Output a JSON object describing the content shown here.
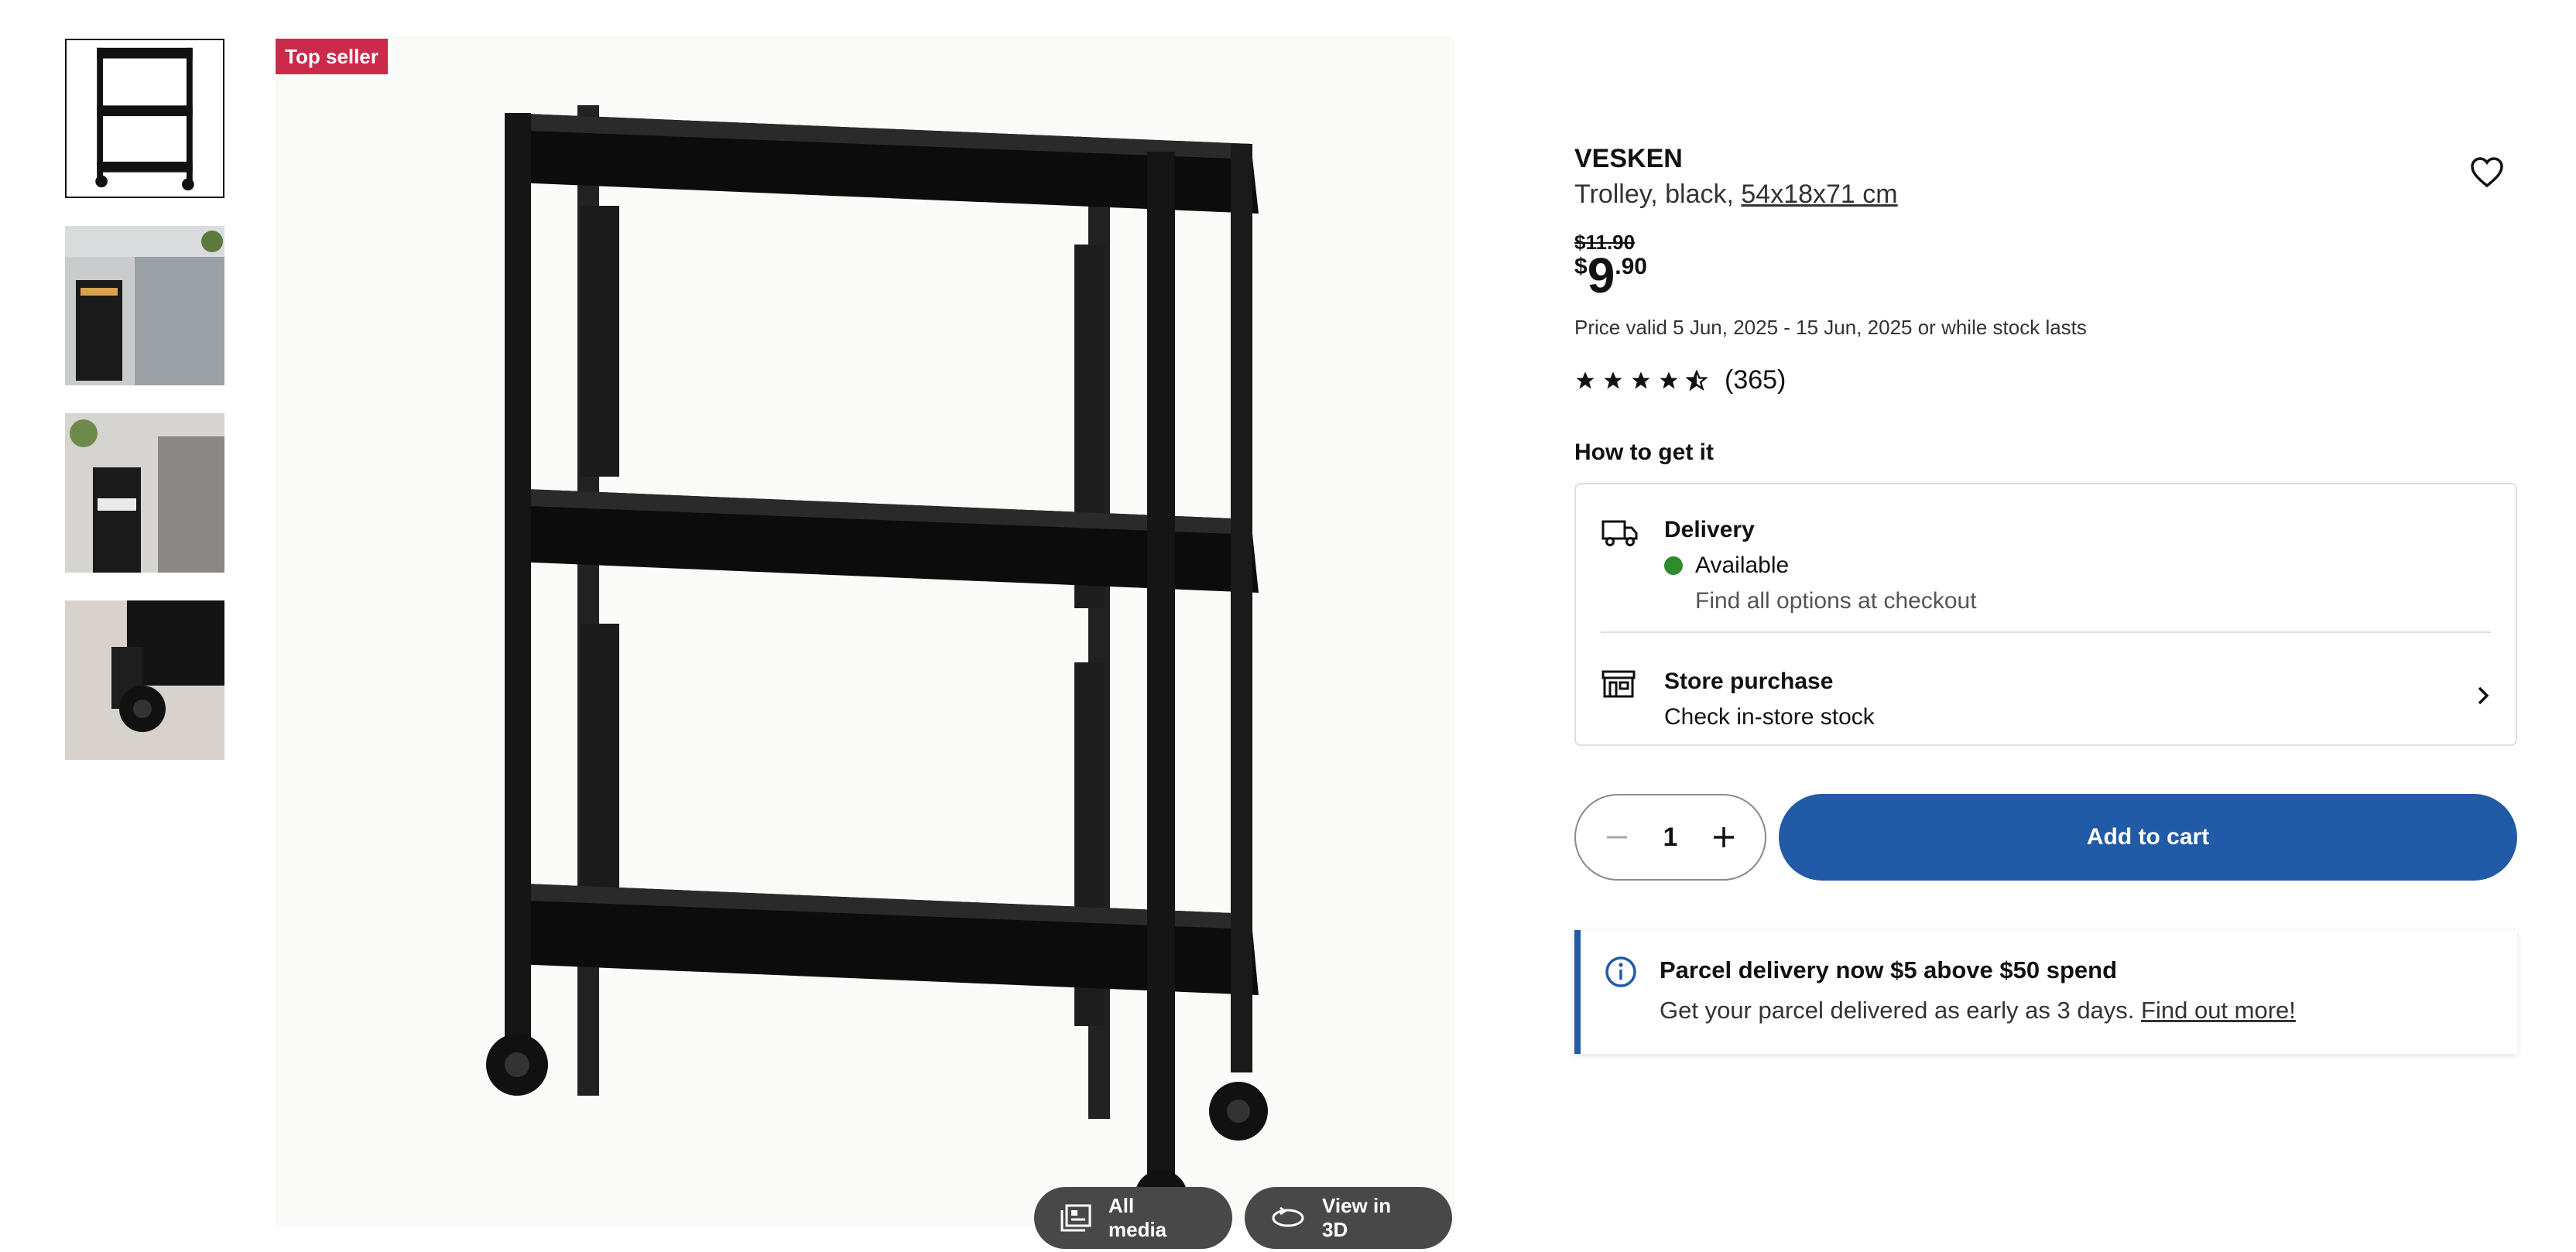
{
  "thumbnails": [
    {
      "name": "trolley-front"
    },
    {
      "name": "trolley-in-kitchen"
    },
    {
      "name": "trolley-in-bathroom"
    },
    {
      "name": "wheel-closeup"
    }
  ],
  "main_image": {
    "badge": "Top seller",
    "all_media_label": "All media",
    "view_3d_label": "View in 3D"
  },
  "product": {
    "name": "VESKEN",
    "description": "Trolley, black, ",
    "dimensions": "54x18x71 cm",
    "old_price": "$11.90",
    "price_currency": "$",
    "price_integer": "9",
    "price_decimal": ".90",
    "price_validity": "Price valid 5 Jun, 2025 - 15 Jun, 2025 or while stock lasts",
    "rating": 4.5,
    "rating_count": "(365)"
  },
  "fulfilment": {
    "heading": "How to get it",
    "delivery": {
      "title": "Delivery",
      "status": "Available",
      "status_color": "#2e8b2e",
      "note": "Find all options at checkout"
    },
    "store": {
      "title": "Store purchase",
      "subtitle": "Check in-store stock"
    }
  },
  "cart": {
    "quantity": "1",
    "add_label": "Add to cart",
    "accent": "#215aa6"
  },
  "info_banner": {
    "title": "Parcel delivery now $5 above $50 spend",
    "body": "Get your parcel delivered as early as 3 days. ",
    "link": "Find out more!"
  }
}
